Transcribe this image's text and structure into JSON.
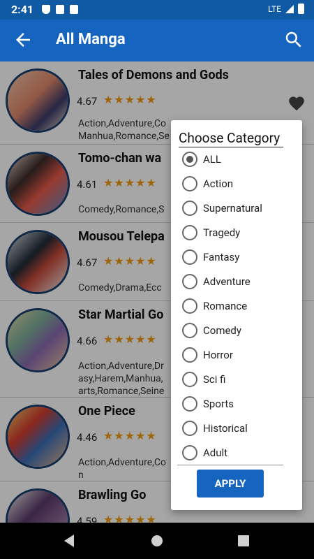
{
  "status": {
    "time": "2:41",
    "network": "LTE"
  },
  "appbar": {
    "title": "All Manga"
  },
  "items": [
    {
      "title": "Tales of Demons and Gods",
      "rating": "4.67",
      "stars": "★★★★★",
      "genres": "Action,Adventure,Co\nManhua,Romance,Se"
    },
    {
      "title": "Tomo-chan wa",
      "rating": "4.61",
      "stars": "★★★★★",
      "genres": "Comedy,Romance,S"
    },
    {
      "title": "Mousou Telepa",
      "rating": "4.67",
      "stars": "★★★★★",
      "genres": "Comedy,Drama,Ecc"
    },
    {
      "title": "Star Martial Go",
      "rating": "4.66",
      "stars": "★★★★★",
      "genres": "Action,Adventure,Dr\nasy,Harem,Manhua,\narts,Romance,Seine"
    },
    {
      "title": "One Piece",
      "rating": "4.46",
      "stars": "★★★★★",
      "genres": "Action,Adventure,Co\nn"
    },
    {
      "title": "Brawling Go",
      "rating": "4.59",
      "stars": "★★★★★",
      "genres": ""
    }
  ],
  "dialog": {
    "title": "Choose Category",
    "options": [
      "ALL",
      "Action",
      "Supernatural",
      "Tragedy",
      "Fantasy",
      "Adventure",
      "Romance",
      "Comedy",
      "Horror",
      "Sci fi",
      "Sports",
      "Historical",
      "Adult"
    ],
    "selected": "ALL",
    "apply_label": "APPLY"
  },
  "colors": {
    "primary": "#1565c0",
    "statusbar": "#0f5aa3",
    "star": "#f29c11"
  }
}
